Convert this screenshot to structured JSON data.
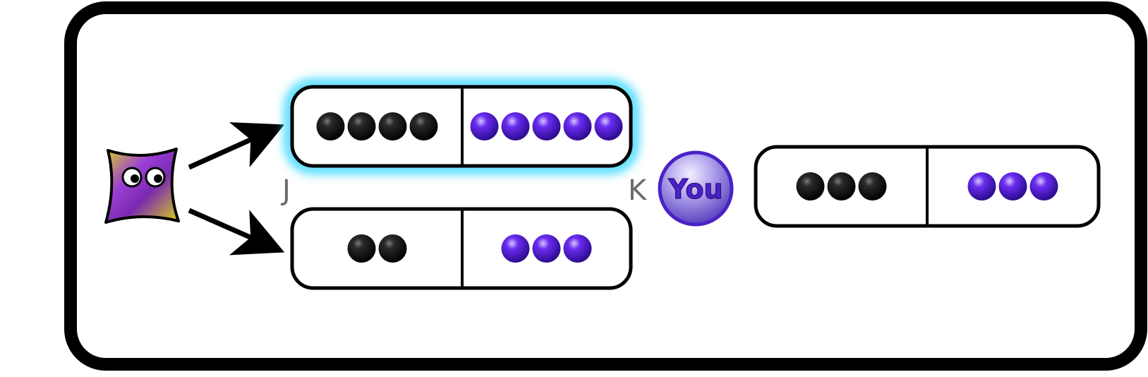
{
  "labels": {
    "left_option": "J",
    "right_option": "K"
  },
  "player_token": {
    "label": "You"
  },
  "options": [
    {
      "id": "J-top",
      "highlighted": true,
      "black_count": 4,
      "purple_count": 5
    },
    {
      "id": "J-bottom",
      "highlighted": false,
      "black_count": 2,
      "purple_count": 3
    },
    {
      "id": "K",
      "highlighted": false,
      "black_count": 3,
      "purple_count": 3
    }
  ],
  "icons": {
    "chooser": "cartoon-creature-icon",
    "arrows": "arrow-right-icon",
    "token": "you-token-icon"
  },
  "colors": {
    "frame": "#000000",
    "highlight_glow": "#38d8ff",
    "black_ball": "#111111",
    "purple_ball": "#5a1fe0",
    "token_fill": "#8a78d8",
    "creature_purple": "#9b3fd6",
    "creature_yellow": "#d8d31a"
  }
}
